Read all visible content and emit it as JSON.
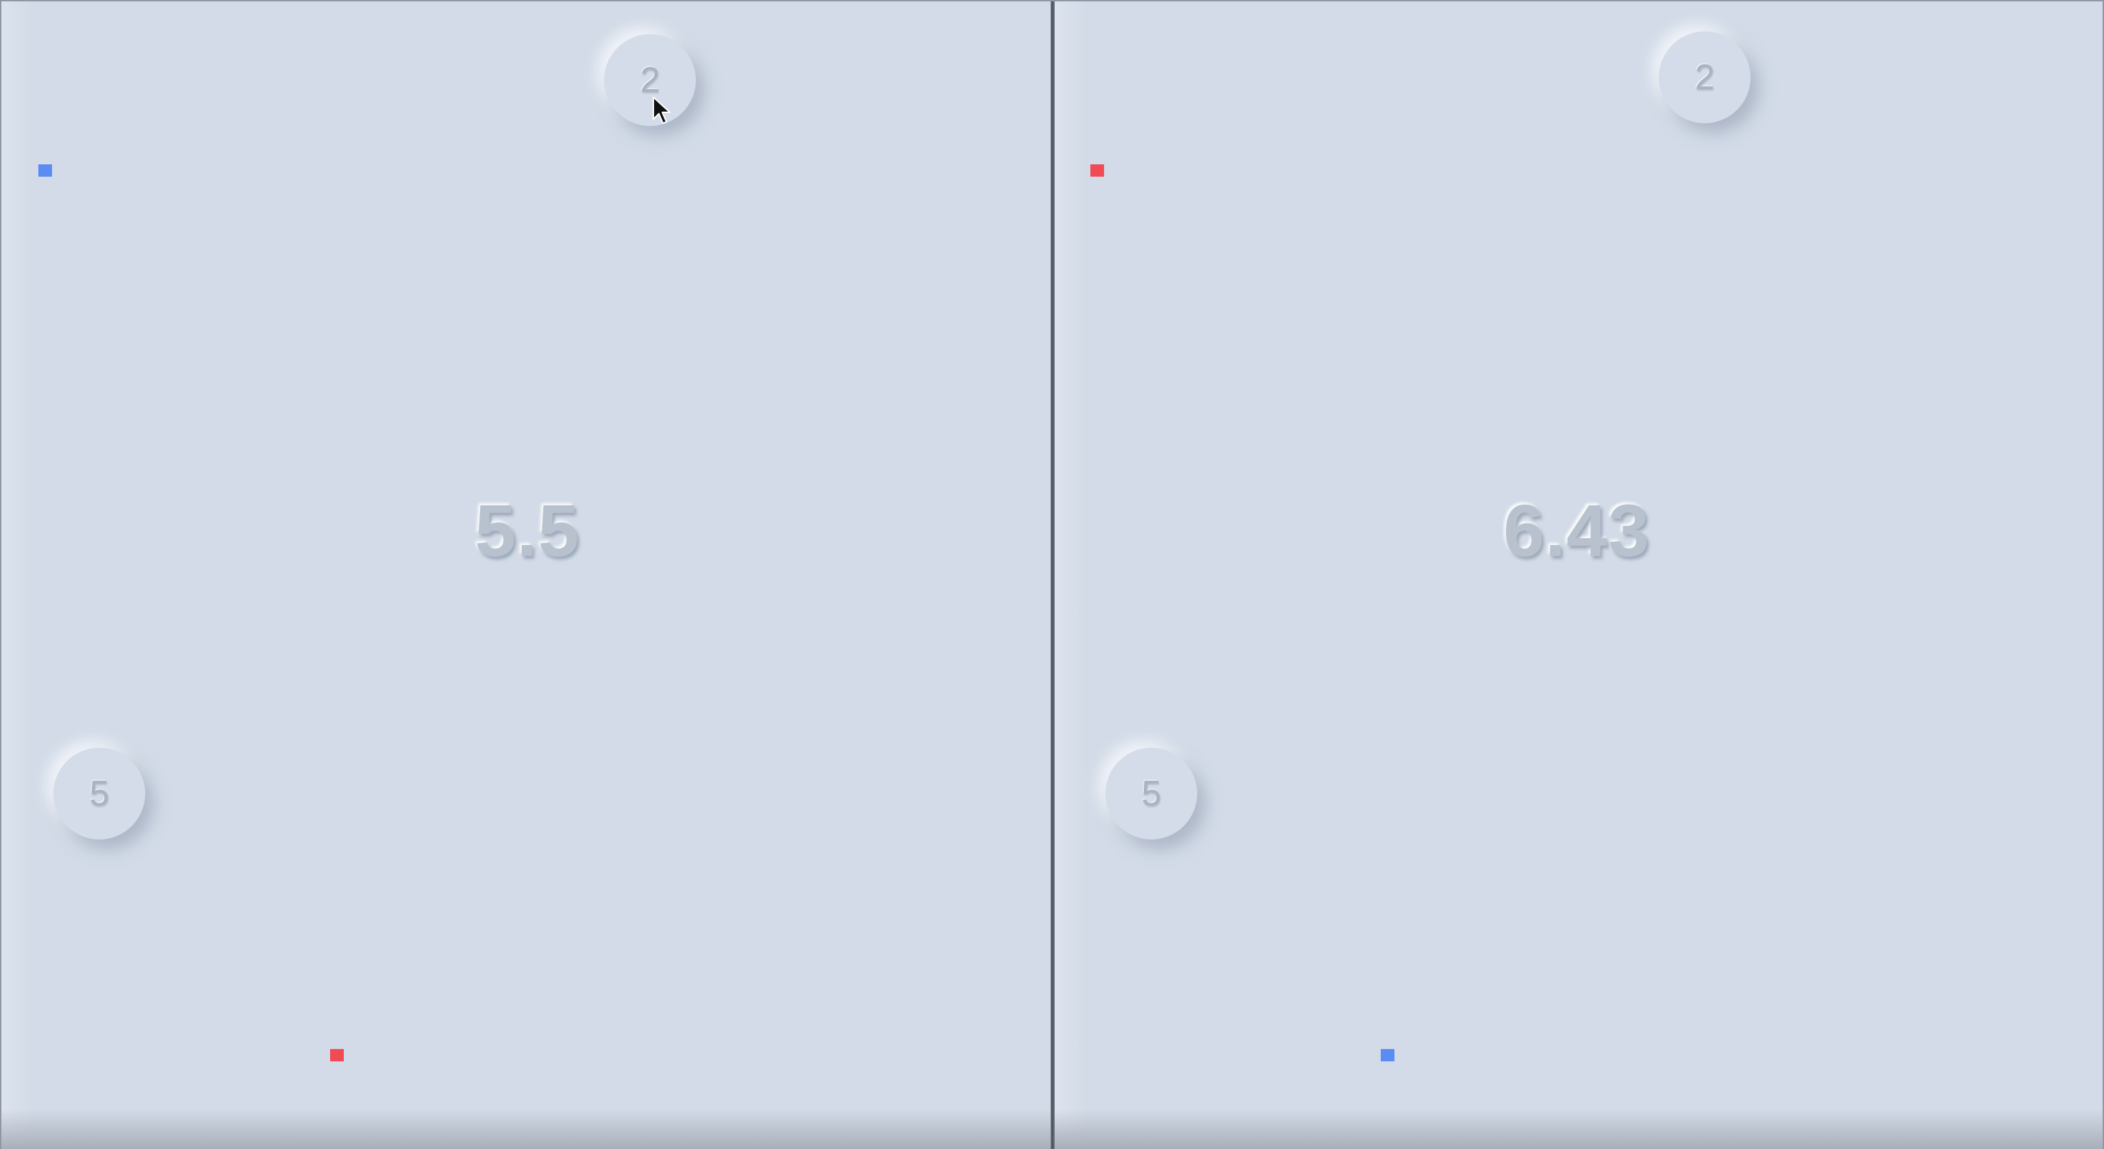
{
  "colors": {
    "background": "#d2dbe7",
    "marker_blue": "#5b8cf3",
    "marker_red": "#f04b55"
  },
  "left_panel": {
    "knob_top": "2",
    "knob_bottom": "5",
    "center_value": "5.5",
    "top_marker_color": "blue",
    "bottom_marker_color": "red"
  },
  "right_panel": {
    "knob_top": "2",
    "knob_bottom": "5",
    "center_value": "6.43",
    "top_marker_color": "red",
    "bottom_marker_color": "blue"
  },
  "cursor": {
    "icon": "arrow-cursor-icon"
  }
}
